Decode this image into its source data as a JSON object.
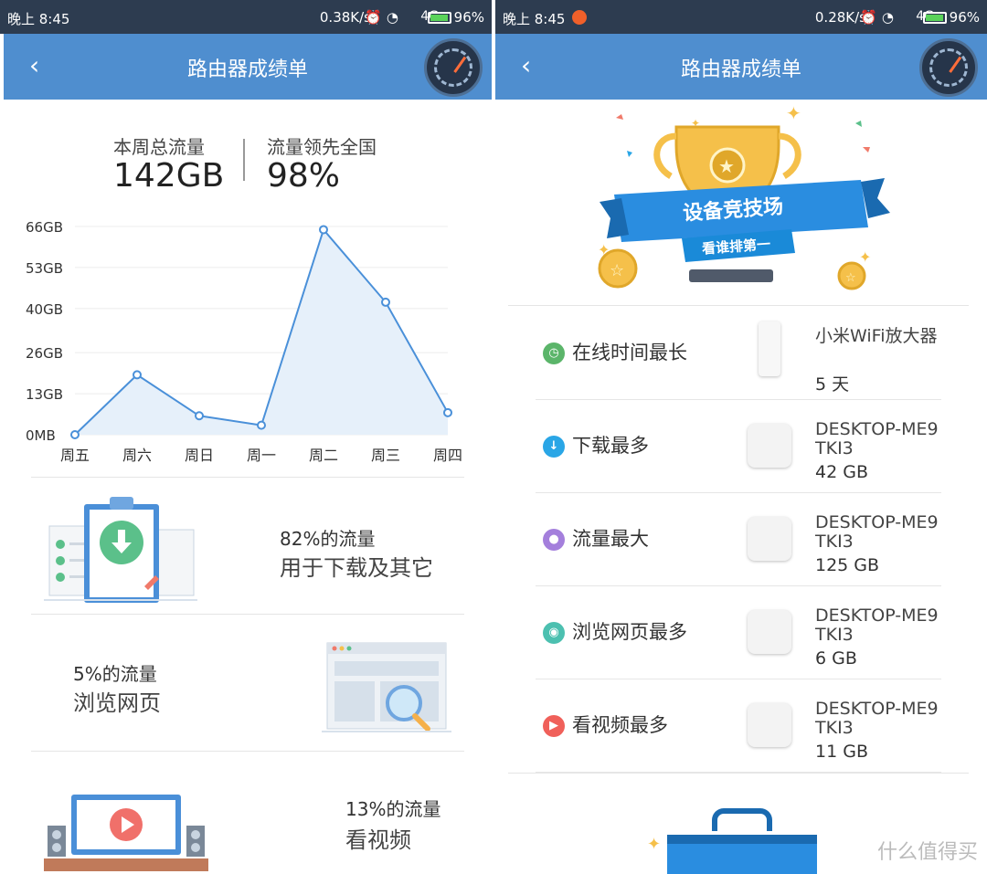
{
  "left": {
    "status": {
      "time": "晚上 8:45",
      "rate": "0.38K/s",
      "net": "4G",
      "battery": "96%"
    },
    "header": {
      "back": "‹",
      "title": "路由器成绩单"
    },
    "summary": {
      "total_label": "本周总流量",
      "total_value": "142GB",
      "rank_label": "流量领先全国",
      "rank_value": "98%"
    },
    "chart_data": {
      "type": "area",
      "categories": [
        "周五",
        "周六",
        "周日",
        "周一",
        "周二",
        "周三",
        "周四"
      ],
      "series": [
        {
          "values": [
            0,
            19,
            6,
            3,
            65,
            42,
            7
          ]
        }
      ],
      "yticks": [
        "66GB",
        "53GB",
        "40GB",
        "26GB",
        "13GB",
        "0MB"
      ],
      "ytick_values": [
        66,
        53,
        40,
        26,
        13,
        0
      ],
      "ylim": [
        0,
        66
      ],
      "grid": true,
      "line_color": "#4a90d9",
      "fill_color": "#e6f0fa"
    },
    "usage": [
      {
        "pct": "82%的流量",
        "desc": "用于下载及其它"
      },
      {
        "pct": "5%的流量",
        "desc": "浏览网页"
      },
      {
        "pct": "13%的流量",
        "desc": "看视频"
      }
    ]
  },
  "right": {
    "status": {
      "time": "晚上 8:45",
      "rate": "0.28K/s",
      "net": "4G",
      "battery": "96%"
    },
    "header": {
      "back": "‹",
      "title": "路由器成绩单"
    },
    "banner": {
      "title": "设备竞技场",
      "subtitle": "看谁排第一"
    },
    "items": [
      {
        "label": "在线时间最长",
        "device": "小米WiFi放大器",
        "value": "5 天",
        "icon_color": "#5bb56a",
        "icon": "clock-icon"
      },
      {
        "label": "下载最多",
        "device": "DESKTOP-ME9TKI3",
        "value": "42 GB",
        "icon_color": "#2aa6e6",
        "icon": "download-icon"
      },
      {
        "label": "流量最大",
        "device": "DESKTOP-ME9TKI3",
        "value": "125 GB",
        "icon_color": "#a47fdc",
        "icon": "drop-icon"
      },
      {
        "label": "浏览网页最多",
        "device": "DESKTOP-ME9TKI3",
        "value": "6 GB",
        "icon_color": "#4cc0b0",
        "icon": "eye-icon"
      },
      {
        "label": "看视频最多",
        "device": "DESKTOP-ME9TKI3",
        "value": "11 GB",
        "icon_color": "#f0605a",
        "icon": "play-icon"
      }
    ],
    "watermark": "什么值得买"
  }
}
